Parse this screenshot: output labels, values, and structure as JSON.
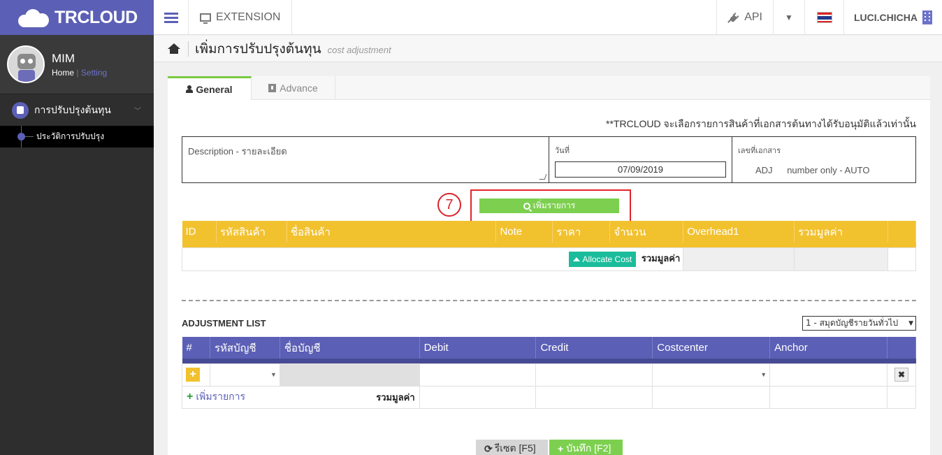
{
  "brand": {
    "logo_text": "TRCLOUD"
  },
  "profile": {
    "name": "MIM",
    "home": "Home",
    "separator": "|",
    "setting": "Setting"
  },
  "sidebar": {
    "menu": {
      "label": "การปรับปรุงต้นทุน"
    },
    "submenu": [
      {
        "label": "ประวัติการปรับปรุง"
      }
    ]
  },
  "topbar": {
    "extension": "EXTENSION",
    "api": "API",
    "user": "LUCI.CHICHA"
  },
  "page": {
    "title": "เพิ่มการปรับปรุงต้นทุน",
    "subtitle": "cost adjustment"
  },
  "tabs": [
    {
      "label": "General"
    },
    {
      "label": "Advance"
    }
  ],
  "notice": "**TRCLOUD จะเลือกรายการสินค้าที่เอกสารต้นทางได้รับอนุมัติแล้วเท่านั้น",
  "doc": {
    "description_label": "Description - รายละเอียด",
    "date_label": "วันที่",
    "date_value": "07/09/2019",
    "docno_label": "เลขที่เอกสาร",
    "docno_prefix": "ADJ",
    "docno_hint": "number only - AUTO"
  },
  "step_number": "7",
  "add_item_button": "เพิ่มรายการ",
  "items_table": {
    "headers": [
      "ID",
      "รหัสสินค้า",
      "ชื่อสินค้า",
      "Note",
      "ราคา",
      "จำนวน",
      "Overhead1",
      "รวมมูลค่า",
      ""
    ],
    "allocate_button": "Allocate Cost",
    "sum_label": "รวมมูลค่า"
  },
  "adjustment": {
    "title": "ADJUSTMENT LIST",
    "book_select": "1 - สมุดบัญชีรายวันทั่วไป",
    "headers": [
      "#",
      "รหัสบัญชี",
      "ชื่อบัญชี",
      "Debit",
      "Credit",
      "Costcenter",
      "Anchor",
      ""
    ],
    "add_link": "เพิ่มรายการ",
    "sum_label": "รวมมูลค่า"
  },
  "footer": {
    "reset": "รีเซต [F5]",
    "save": "บันทึก [F2]"
  },
  "colors": {
    "brand": "#5b5fb5",
    "yellow": "#f2c12e",
    "green": "#7dd04f",
    "teal": "#1bbc9b",
    "red": "#e3242b"
  }
}
